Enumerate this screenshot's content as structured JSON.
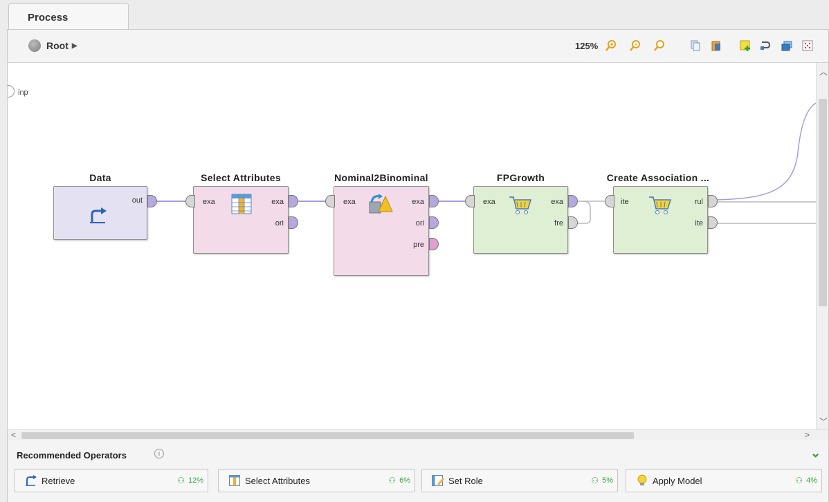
{
  "tab": {
    "label": "Process"
  },
  "toolbar": {
    "root_label": "Root",
    "zoom": "125%",
    "icons": [
      "zoom-in-icon",
      "zoom-out-icon",
      "zoom-fit-icon",
      "copy-icon",
      "paste-icon",
      "add-note-icon",
      "auto-wire-icon",
      "layers-icon",
      "grid-icon"
    ]
  },
  "canvas": {
    "input_port_label": "inp",
    "operators": [
      {
        "title": "Data",
        "color": "#e4e2f2",
        "in_ports": [],
        "out_ports": [
          "out"
        ]
      },
      {
        "title": "Select Attributes",
        "color": "#f3dbea",
        "in_ports": [
          "exa"
        ],
        "out_ports": [
          "exa",
          "ori"
        ]
      },
      {
        "title": "Nominal2Binominal",
        "color": "#f3dbea",
        "in_ports": [
          "exa"
        ],
        "out_ports": [
          "exa",
          "ori",
          "pre"
        ]
      },
      {
        "title": "FPGrowth",
        "color": "#dfefd3",
        "in_ports": [
          "exa"
        ],
        "out_ports": [
          "exa",
          "fre"
        ]
      },
      {
        "title": "Create Association ...",
        "color": "#dfefd3",
        "in_ports": [
          "ite"
        ],
        "out_ports": [
          "rul",
          "ite"
        ]
      }
    ]
  },
  "recommended": {
    "title": "Recommended Operators",
    "items": [
      {
        "label": "Retrieve",
        "pct": "12%",
        "icon": "retrieve-icon"
      },
      {
        "label": "Select Attributes",
        "pct": "6%",
        "icon": "select-attributes-icon"
      },
      {
        "label": "Set Role",
        "pct": "5%",
        "icon": "set-role-icon"
      },
      {
        "label": "Apply Model",
        "pct": "4%",
        "icon": "lightbulb-icon"
      }
    ]
  },
  "colors": {
    "wire": "#a79ce0",
    "grey_wire": "#b8b8b8",
    "accent_green": "#2e9e3c"
  }
}
